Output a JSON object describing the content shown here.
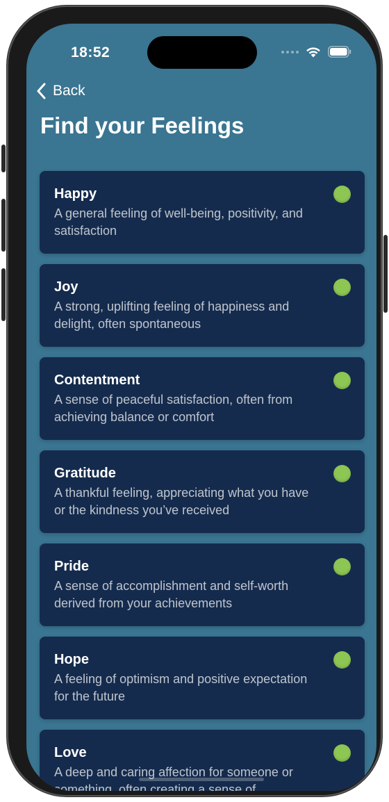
{
  "status_bar": {
    "time": "18:52",
    "icons": [
      "cellular-signal-icon",
      "wifi-icon",
      "battery-icon"
    ]
  },
  "nav": {
    "back_label": "Back",
    "back_icon": "chevron-left-icon"
  },
  "page": {
    "title": "Find your Feelings"
  },
  "colors": {
    "background": "#3a7591",
    "card": "#152b4d",
    "indicator": "#8dc653"
  },
  "feelings": [
    {
      "name": "Happy",
      "description": "A general feeling of well-being, positivity, and satisfaction"
    },
    {
      "name": "Joy",
      "description": "A strong, uplifting feeling of happiness and delight, often spontaneous"
    },
    {
      "name": "Contentment",
      "description": "A sense of peaceful satisfaction, often from achieving balance or comfort"
    },
    {
      "name": "Gratitude",
      "description": "A thankful feeling, appreciating what you have or the kindness you’ve received"
    },
    {
      "name": "Pride",
      "description": "A sense of accomplishment and self-worth derived from your achievements"
    },
    {
      "name": "Hope",
      "description": "A feeling of optimism and positive expectation for the future"
    },
    {
      "name": "Love",
      "description": "A deep and caring affection for someone or something, often creating a sense of"
    }
  ]
}
